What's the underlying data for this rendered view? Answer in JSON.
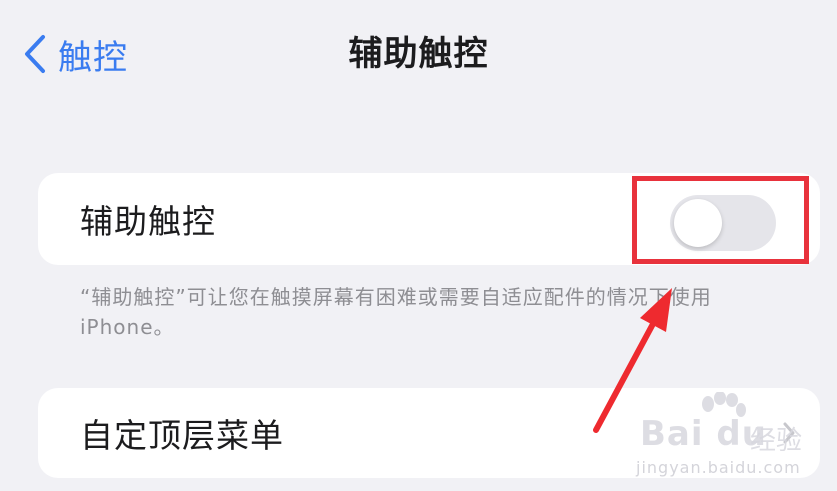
{
  "nav": {
    "back_label": "触控",
    "title": "辅助触控"
  },
  "assistive_touch": {
    "label": "辅助触控",
    "toggle_on": false,
    "footnote": "“辅助触控”可让您在触摸屏幕有困难或需要自适应配件的情况下使用 iPhone。"
  },
  "custom_menu": {
    "label": "自定顶层菜单"
  },
  "annotation": {
    "highlight_color": "#e8323c",
    "arrow_color": "#ee2a2f"
  },
  "watermark": {
    "brand": "Bai du",
    "product": "经验",
    "domain": "jingyan.baidu.com"
  },
  "colors": {
    "background": "#f1f1f5",
    "accent": "#3a7cf0",
    "toggle_off": "#e5e5ea",
    "secondary_text": "#8e8e93"
  }
}
